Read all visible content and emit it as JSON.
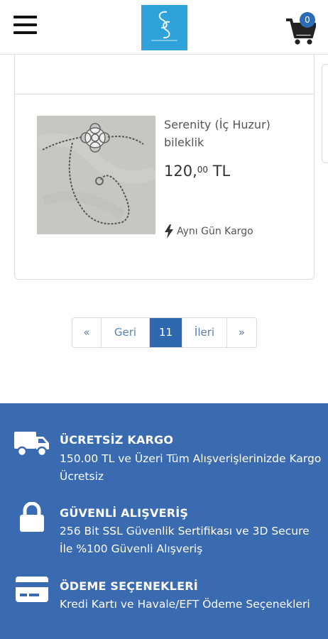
{
  "header": {
    "menu_icon": "hamburger-icon",
    "logo_icon": "brand-logo",
    "cart_icon": "shopping-cart-icon",
    "cart_count": "0"
  },
  "product": {
    "name": "Serenity (İç Huzur) bileklik",
    "price_whole": "120,",
    "price_decimal": "00",
    "price_currency": "TL",
    "shipping_icon": "lightning-icon",
    "shipping_label": "Aynı Gün Kargo"
  },
  "pagination": {
    "first": "«",
    "prev": "Geri",
    "current": "11",
    "next": "İleri",
    "last": "»"
  },
  "footer": {
    "features": [
      {
        "icon": "truck-icon",
        "title": "ÜCRETSİZ KARGO",
        "description": "150.00 TL ve Üzeri Tüm Alışverişlerinizde Kargo Ücretsiz"
      },
      {
        "icon": "lock-icon",
        "title": "GÜVENLİ ALIŞVERİŞ",
        "description": "256 Bit SSL Güvenlik Sertifikası ve 3D Secure İle %100 Güvenli Alışveriş"
      },
      {
        "icon": "credit-card-icon",
        "title": "ÖDEME SEÇENEKLERİ",
        "description": "Kredi Kartı ve Havale/EFT Ödeme Seçenekleri"
      }
    ]
  },
  "colors": {
    "footer_bg": "#3a6ab0",
    "active_page": "#2e68ae",
    "logo_bg": "#2fa3d9",
    "badge": "#2a6db5"
  }
}
